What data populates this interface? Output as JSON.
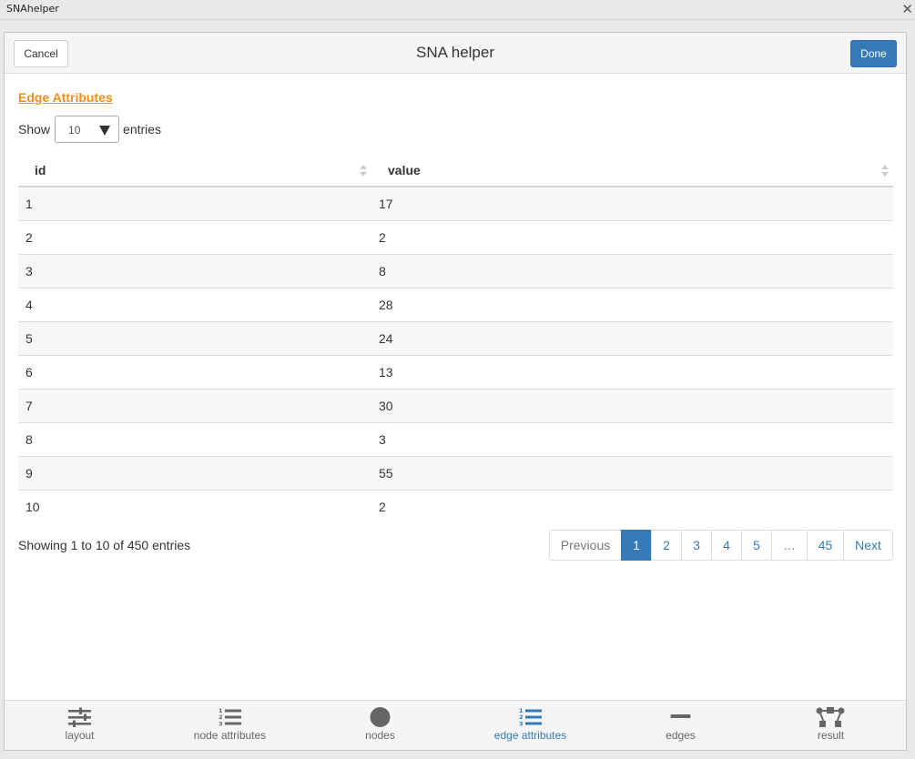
{
  "window": {
    "title": "SNAhelper",
    "close_symbol": "✕"
  },
  "dialog": {
    "title": "SNA helper",
    "cancel_label": "Cancel",
    "done_label": "Done"
  },
  "section": {
    "title": "Edge Attributes"
  },
  "length_menu": {
    "show_label": "Show",
    "value": "10",
    "entries_label": "entries"
  },
  "table": {
    "columns": [
      "id",
      "value"
    ],
    "rows": [
      [
        "1",
        "17"
      ],
      [
        "2",
        "2"
      ],
      [
        "3",
        "8"
      ],
      [
        "4",
        "28"
      ],
      [
        "5",
        "24"
      ],
      [
        "6",
        "13"
      ],
      [
        "7",
        "30"
      ],
      [
        "8",
        "3"
      ],
      [
        "9",
        "55"
      ],
      [
        "10",
        "2"
      ]
    ]
  },
  "info": "Showing 1 to 10 of 450 entries",
  "pagination": {
    "previous": "Previous",
    "pages": [
      "1",
      "2",
      "3",
      "4",
      "5"
    ],
    "ellipsis": "…",
    "last_page": "45",
    "next": "Next",
    "active_page": "1"
  },
  "nav": [
    {
      "label": "layout",
      "icon": "sliders-icon",
      "active": false
    },
    {
      "label": "node attributes",
      "icon": "numbered-list-icon",
      "active": false
    },
    {
      "label": "nodes",
      "icon": "circle-icon",
      "active": false
    },
    {
      "label": "edge attributes",
      "icon": "numbered-list-icon",
      "active": true
    },
    {
      "label": "edges",
      "icon": "minus-icon",
      "active": false
    },
    {
      "label": "result",
      "icon": "network-icon",
      "active": false
    }
  ],
  "colors": {
    "accent": "#337ab7",
    "section_title": "#f0901a",
    "nav_inactive_icon": "#666666"
  }
}
